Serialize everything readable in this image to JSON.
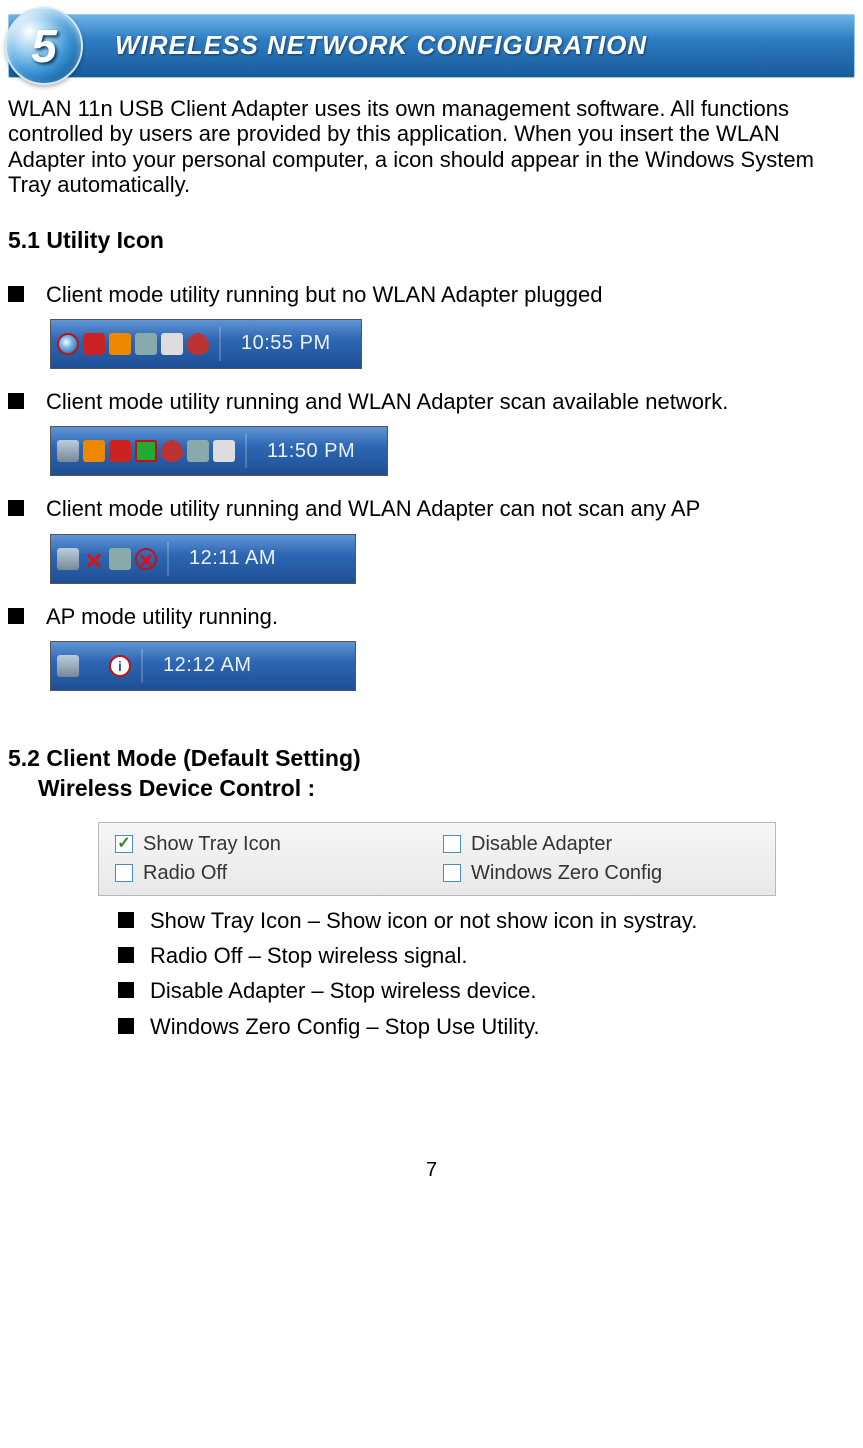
{
  "header": {
    "number": "5",
    "title": "WIRELESS NETWORK CONFIGURATION"
  },
  "intro": "WLAN 11n USB Client Adapter uses its own management software. All functions controlled by users are provided by this application. When you insert the WLAN Adapter into your personal computer, a icon should appear in the Windows System Tray automatically.",
  "section51": {
    "heading": "5.1 Utility Icon",
    "items": [
      {
        "text": "Client mode utility running but no WLAN Adapter plugged",
        "time": "10:55 PM"
      },
      {
        "text": "Client mode utility running and WLAN Adapter scan available network.",
        "time": "11:50 PM"
      },
      {
        "text": "Client mode utility running and WLAN Adapter can not scan any AP",
        "time": "12:11 AM"
      },
      {
        "text": "AP mode utility running.",
        "time": "12:12 AM"
      }
    ]
  },
  "section52": {
    "heading": "5.2 Client Mode (Default Setting)",
    "subheading": "Wireless Device Control :",
    "checkboxes": [
      {
        "label": "Show Tray Icon",
        "checked": true
      },
      {
        "label": "Disable Adapter",
        "checked": false
      },
      {
        "label": "Radio Off",
        "checked": false
      },
      {
        "label": "Windows Zero Config",
        "checked": false
      }
    ],
    "explain": [
      "Show Tray Icon – Show icon or not show icon in systray.",
      "Radio Off – Stop wireless signal.",
      "Disable Adapter – Stop wireless device.",
      "Windows Zero Config – Stop Use Utility."
    ]
  },
  "pageNumber": "7"
}
